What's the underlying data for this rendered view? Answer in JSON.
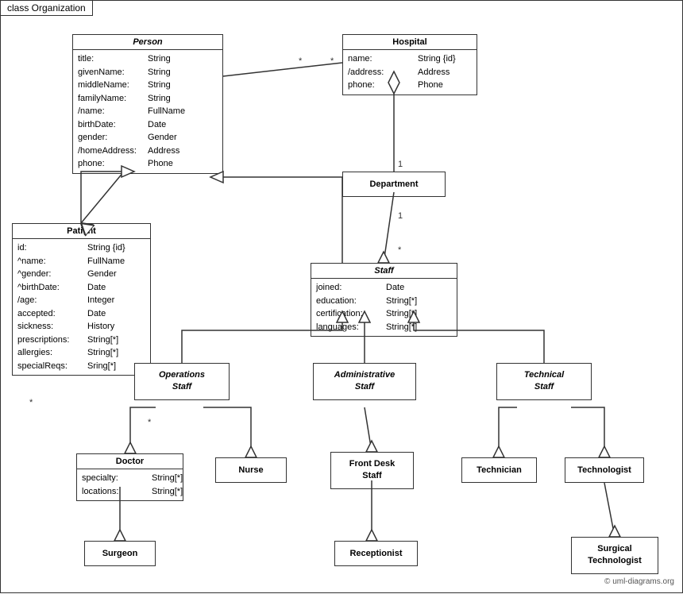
{
  "title": "class Organization",
  "copyright": "© uml-diagrams.org",
  "boxes": {
    "person": {
      "title": "Person",
      "italic": true,
      "attrs": [
        [
          "title:",
          "String"
        ],
        [
          "givenName:",
          "String"
        ],
        [
          "middleName:",
          "String"
        ],
        [
          "familyName:",
          "String"
        ],
        [
          "/name:",
          "FullName"
        ],
        [
          "birthDate:",
          "Date"
        ],
        [
          "gender:",
          "Gender"
        ],
        [
          "/homeAddress:",
          "Address"
        ],
        [
          "phone:",
          "Phone"
        ]
      ]
    },
    "hospital": {
      "title": "Hospital",
      "attrs": [
        [
          "name:",
          "String {id}"
        ],
        [
          "/address:",
          "Address"
        ],
        [
          "phone:",
          "Phone"
        ]
      ]
    },
    "patient": {
      "title": "Patient",
      "attrs": [
        [
          "id:",
          "String {id}"
        ],
        [
          "^name:",
          "FullName"
        ],
        [
          "^gender:",
          "Gender"
        ],
        [
          "^birthDate:",
          "Date"
        ],
        [
          "/age:",
          "Integer"
        ],
        [
          "accepted:",
          "Date"
        ],
        [
          "sickness:",
          "History"
        ],
        [
          "prescriptions:",
          "String[*]"
        ],
        [
          "allergies:",
          "String[*]"
        ],
        [
          "specialReqs:",
          "Sring[*]"
        ]
      ]
    },
    "department": {
      "title": "Department",
      "attrs": []
    },
    "staff": {
      "title": "Staff",
      "italic": true,
      "attrs": [
        [
          "joined:",
          "Date"
        ],
        [
          "education:",
          "String[*]"
        ],
        [
          "certification:",
          "String[*]"
        ],
        [
          "languages:",
          "String[*]"
        ]
      ]
    },
    "operations_staff": {
      "title": "Operations Staff",
      "italic": true,
      "attrs": []
    },
    "administrative_staff": {
      "title": "Administrative Staff",
      "italic": true,
      "attrs": []
    },
    "technical_staff": {
      "title": "Technical Staff",
      "italic": true,
      "attrs": []
    },
    "doctor": {
      "title": "Doctor",
      "attrs": [
        [
          "specialty:",
          "String[*]"
        ],
        [
          "locations:",
          "String[*]"
        ]
      ]
    },
    "nurse": {
      "title": "Nurse",
      "attrs": []
    },
    "front_desk_staff": {
      "title": "Front Desk Staff",
      "attrs": []
    },
    "technician": {
      "title": "Technician",
      "attrs": []
    },
    "technologist": {
      "title": "Technologist",
      "attrs": []
    },
    "surgeon": {
      "title": "Surgeon",
      "attrs": []
    },
    "receptionist": {
      "title": "Receptionist",
      "attrs": []
    },
    "surgical_technologist": {
      "title": "Surgical Technologist",
      "attrs": []
    }
  }
}
